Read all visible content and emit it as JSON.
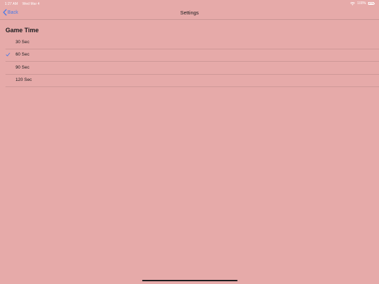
{
  "status_bar": {
    "time": "1:27 AM",
    "date": "Wed Mar 4",
    "battery_text": "100%",
    "wifi_icon": "wifi-icon",
    "battery_icon": "battery-full-icon"
  },
  "nav": {
    "back_label": "Back",
    "back_icon": "chevron-left-icon",
    "title": "Settings"
  },
  "section": {
    "title": "Game Time"
  },
  "options": [
    {
      "label": "30 Sec",
      "selected": false
    },
    {
      "label": "60 Sec",
      "selected": true
    },
    {
      "label": "90 Sec",
      "selected": false
    },
    {
      "label": "120 Sec",
      "selected": false
    }
  ],
  "colors": {
    "background": "#e6aaa9",
    "accent": "#4a79e6",
    "text": "#1c1c1e"
  }
}
